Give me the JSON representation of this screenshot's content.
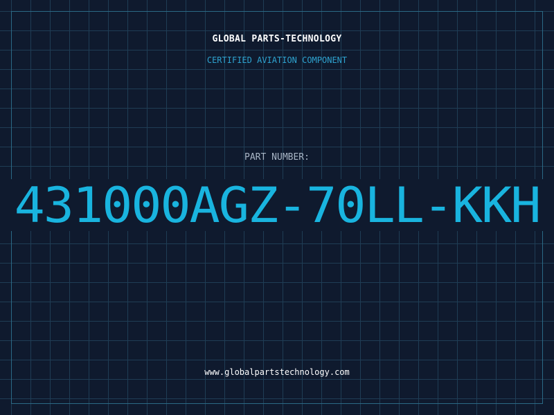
{
  "header": {
    "brand": "GLOBAL PARTS-TECHNOLOGY",
    "subtitle": "CERTIFIED AVIATION COMPONENT"
  },
  "part": {
    "label": "PART NUMBER:",
    "number": "431000AGZ-70LL-KKH"
  },
  "footer": {
    "website": "www.globalpartstechnology.com"
  },
  "colors": {
    "background": "#0f1a2e",
    "grid": "#1f3d55",
    "accent": "#19b4df",
    "subtitle": "#2ea3d0",
    "label": "#a9b6c6",
    "text": "#ffffff"
  }
}
